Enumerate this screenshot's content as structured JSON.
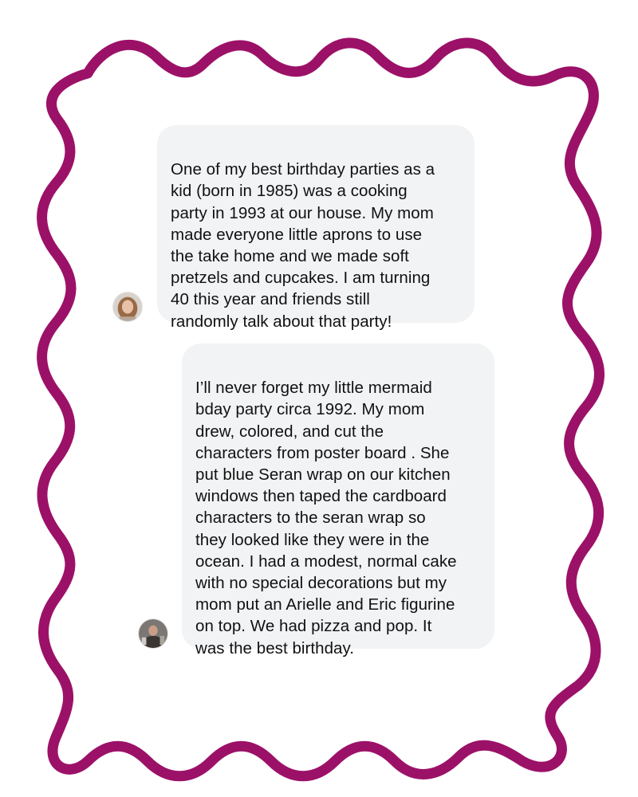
{
  "theme": {
    "frame_color": "#9c1168",
    "bubble_color": "#f2f3f5",
    "text_color": "#111111"
  },
  "comments": [
    {
      "avatar_icon": "user-avatar-photo-icon",
      "text": "One of my best birthday parties as a\nkid (born in 1985) was a cooking\nparty in 1993 at our house. My mom\nmade everyone little aprons to use\nthe take home and we made soft\npretzels and cupcakes. I am turning\n40 this year and friends still\nrandomly talk about that party!"
    },
    {
      "avatar_icon": "user-avatar-photo-icon",
      "text": "I’ll never forget my little mermaid\nbday party circa 1992. My mom\ndrew, colored, and cut the\ncharacters from poster board . She\nput blue Seran wrap on our kitchen\nwindows then taped the cardboard\ncharacters to the seran wrap so\nthey looked like they were in the\nocean. I had a modest, normal cake\nwith no special decorations but my\nmom put an Arielle and Eric figurine\non top. We had pizza and pop. It\nwas the best birthday."
    }
  ]
}
